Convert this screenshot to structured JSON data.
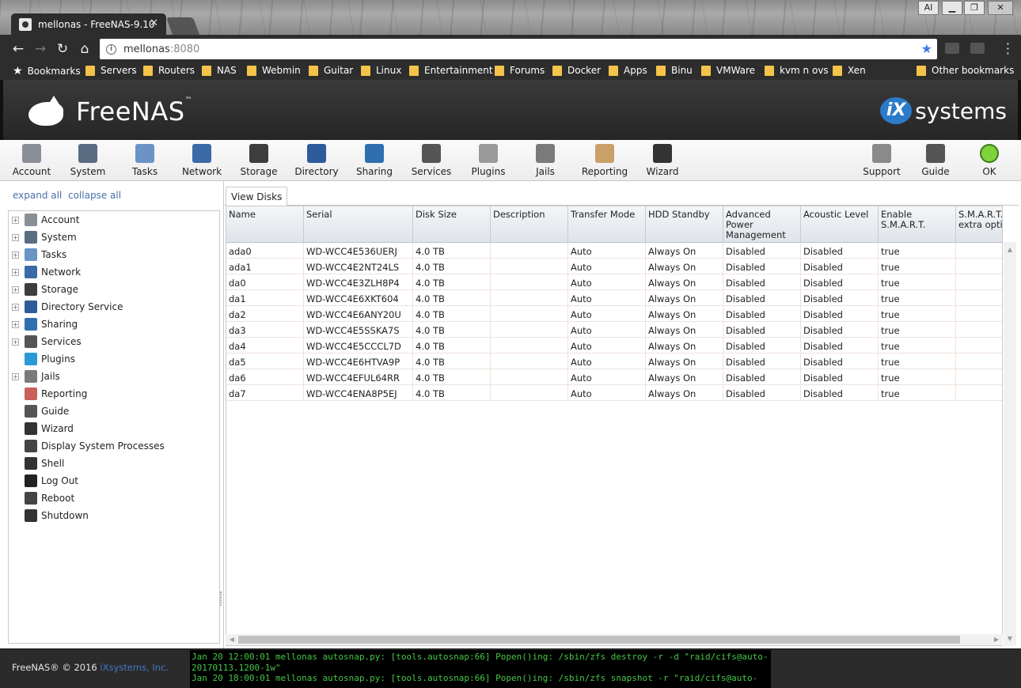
{
  "browser": {
    "tab_title": "mellonas - FreeNAS-9.10",
    "url_host": "mellonas",
    "url_port": ":8080",
    "window_buttons": [
      "AI",
      "▁",
      "❐",
      "✕"
    ],
    "bookmarks": [
      "Bookmarks",
      "Servers",
      "Routers",
      "NAS",
      "Webmin",
      "Guitar",
      "Linux",
      "Entertainment",
      "Forums",
      "Docker",
      "Apps",
      "Binu",
      "VMWare",
      "kvm n ovs",
      "Xen"
    ],
    "other_bookmarks": "Other bookmarks"
  },
  "header": {
    "brand": "FreeNAS",
    "brand_tm": "™",
    "vendor": "systems",
    "vendor_mark": "iX"
  },
  "topnav": [
    {
      "label": "Account",
      "icon": "account-icon",
      "color": "#8a8f97"
    },
    {
      "label": "System",
      "icon": "system-icon",
      "color": "#5a6c82"
    },
    {
      "label": "Tasks",
      "icon": "tasks-icon",
      "color": "#6b93c6"
    },
    {
      "label": "Network",
      "icon": "network-icon",
      "color": "#3b6aa8"
    },
    {
      "label": "Storage",
      "icon": "storage-icon",
      "color": "#3d3d3d"
    },
    {
      "label": "Directory",
      "icon": "directory-icon",
      "color": "#2e5c9a"
    },
    {
      "label": "Sharing",
      "icon": "sharing-icon",
      "color": "#2f6fb0"
    },
    {
      "label": "Services",
      "icon": "services-icon",
      "color": "#555"
    },
    {
      "label": "Plugins",
      "icon": "plugins-icon",
      "color": "#9a9a9a"
    },
    {
      "label": "Jails",
      "icon": "jails-icon",
      "color": "#7a7a7a"
    },
    {
      "label": "Reporting",
      "icon": "reporting-icon",
      "color": "#c9a06a"
    },
    {
      "label": "Wizard",
      "icon": "wizard-icon",
      "color": "#333"
    },
    {
      "label": "Support",
      "icon": "support-icon",
      "color": "#8a8a8a"
    },
    {
      "label": "Guide",
      "icon": "guide-icon",
      "color": "#555"
    },
    {
      "label": "OK",
      "icon": "ok-status-icon",
      "color": "#7fd23a"
    }
  ],
  "sidebar": {
    "expand_all": "expand all",
    "collapse_all": "collapse all",
    "items": [
      {
        "label": "Account",
        "expandable": true,
        "icon": "account-icon",
        "color": "#8a8f97"
      },
      {
        "label": "System",
        "expandable": true,
        "icon": "system-icon",
        "color": "#5a6c82"
      },
      {
        "label": "Tasks",
        "expandable": true,
        "icon": "tasks-icon",
        "color": "#6b93c6"
      },
      {
        "label": "Network",
        "expandable": true,
        "icon": "network-icon",
        "color": "#3b6aa8"
      },
      {
        "label": "Storage",
        "expandable": true,
        "icon": "storage-icon",
        "color": "#3d3d3d"
      },
      {
        "label": "Directory Service",
        "expandable": true,
        "icon": "directory-icon",
        "color": "#2e5c9a"
      },
      {
        "label": "Sharing",
        "expandable": true,
        "icon": "sharing-icon",
        "color": "#2f6fb0"
      },
      {
        "label": "Services",
        "expandable": true,
        "icon": "services-icon",
        "color": "#555"
      },
      {
        "label": "Plugins",
        "expandable": false,
        "icon": "plugins-icon",
        "color": "#2a9ad6"
      },
      {
        "label": "Jails",
        "expandable": true,
        "icon": "jails-icon",
        "color": "#7a7a7a"
      },
      {
        "label": "Reporting",
        "expandable": false,
        "icon": "reporting-icon",
        "color": "#c9605a"
      },
      {
        "label": "Guide",
        "expandable": false,
        "icon": "guide-icon",
        "color": "#555"
      },
      {
        "label": "Wizard",
        "expandable": false,
        "icon": "wizard-icon",
        "color": "#333"
      },
      {
        "label": "Display System Processes",
        "expandable": false,
        "icon": "processes-icon",
        "color": "#444"
      },
      {
        "label": "Shell",
        "expandable": false,
        "icon": "shell-icon",
        "color": "#333"
      },
      {
        "label": "Log Out",
        "expandable": false,
        "icon": "logout-icon",
        "color": "#222"
      },
      {
        "label": "Reboot",
        "expandable": false,
        "icon": "reboot-icon",
        "color": "#444"
      },
      {
        "label": "Shutdown",
        "expandable": false,
        "icon": "shutdown-icon",
        "color": "#333"
      }
    ]
  },
  "main": {
    "tab_label": "View Disks",
    "columns": [
      "Name",
      "Serial",
      "Disk Size",
      "Description",
      "Transfer Mode",
      "HDD Standby",
      "Advanced Power Management",
      "Acoustic Level",
      "Enable S.M.A.R.T.",
      "S.M.A.R.T. extra opti"
    ],
    "rows": [
      [
        "ada0",
        "WD-WCC4E536UERJ",
        "4.0 TB",
        "",
        "Auto",
        "Always On",
        "Disabled",
        "Disabled",
        "true",
        ""
      ],
      [
        "ada1",
        "WD-WCC4E2NT24LS",
        "4.0 TB",
        "",
        "Auto",
        "Always On",
        "Disabled",
        "Disabled",
        "true",
        ""
      ],
      [
        "da0",
        "WD-WCC4E3ZLH8P4",
        "4.0 TB",
        "",
        "Auto",
        "Always On",
        "Disabled",
        "Disabled",
        "true",
        ""
      ],
      [
        "da1",
        "WD-WCC4E6XKT604",
        "4.0 TB",
        "",
        "Auto",
        "Always On",
        "Disabled",
        "Disabled",
        "true",
        ""
      ],
      [
        "da2",
        "WD-WCC4E6ANY20U",
        "4.0 TB",
        "",
        "Auto",
        "Always On",
        "Disabled",
        "Disabled",
        "true",
        ""
      ],
      [
        "da3",
        "WD-WCC4E5SSKA7S",
        "4.0 TB",
        "",
        "Auto",
        "Always On",
        "Disabled",
        "Disabled",
        "true",
        ""
      ],
      [
        "da4",
        "WD-WCC4E5CCCL7D",
        "4.0 TB",
        "",
        "Auto",
        "Always On",
        "Disabled",
        "Disabled",
        "true",
        ""
      ],
      [
        "da5",
        "WD-WCC4E6HTVA9P",
        "4.0 TB",
        "",
        "Auto",
        "Always On",
        "Disabled",
        "Disabled",
        "true",
        ""
      ],
      [
        "da6",
        "WD-WCC4EFUL64RR",
        "4.0 TB",
        "",
        "Auto",
        "Always On",
        "Disabled",
        "Disabled",
        "true",
        ""
      ],
      [
        "da7",
        "WD-WCC4ENA8P5EJ",
        "4.0 TB",
        "",
        "Auto",
        "Always On",
        "Disabled",
        "Disabled",
        "true",
        ""
      ]
    ]
  },
  "footer": {
    "copyright": "FreeNAS® © 2016 ",
    "company": "iXsystems, Inc.",
    "console_lines": [
      "Jan 20 12:00:01 mellonas autosnap.py: [tools.autosnap:66] Popen()ing: /sbin/zfs destroy -r -d \"raid/cifs@auto-",
      "20170113.1200-1w\"",
      "Jan 20 18:00:01 mellonas autosnap.py: [tools.autosnap:66] Popen()ing: /sbin/zfs snapshot -r \"raid/cifs@auto-"
    ]
  }
}
